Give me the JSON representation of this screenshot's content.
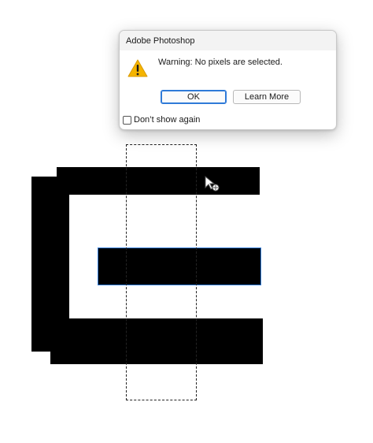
{
  "dialog": {
    "title": "Adobe Photoshop",
    "message": "Warning: No pixels are selected.",
    "ok_label": "OK",
    "learn_more_label": "Learn More",
    "dont_show_label": "Don’t show again",
    "dont_show_checked": false,
    "icon": "warning-icon"
  },
  "colors": {
    "shape_fill": "#000000",
    "selection_outline": "#2f7ad8",
    "warning_yellow": "#f5b400"
  },
  "canvas": {
    "cursor_icon": "move-cursor-icon"
  }
}
